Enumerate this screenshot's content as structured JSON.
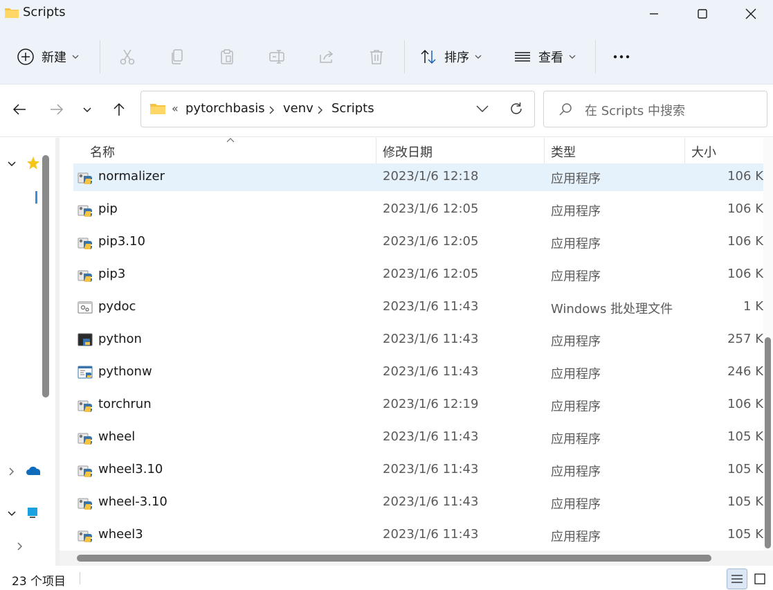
{
  "window": {
    "title": "Scripts"
  },
  "toolbar": {
    "new_label": "新建",
    "sort_label": "排序",
    "view_label": "查看"
  },
  "address": {
    "overflow": "«",
    "crumbs": [
      "pytorchbasis",
      "venv",
      "Scripts"
    ]
  },
  "search": {
    "placeholder": "在 Scripts 中搜索"
  },
  "columns": {
    "name": "名称",
    "date": "修改日期",
    "type": "类型",
    "size": "大小"
  },
  "files": [
    {
      "name": "normalizer",
      "date": "2023/1/6 12:18",
      "type": "应用程序",
      "size": "106 K",
      "icon": "python-exe-icon"
    },
    {
      "name": "pip",
      "date": "2023/1/6 12:05",
      "type": "应用程序",
      "size": "106 K",
      "icon": "python-exe-icon"
    },
    {
      "name": "pip3.10",
      "date": "2023/1/6 12:05",
      "type": "应用程序",
      "size": "106 K",
      "icon": "python-exe-icon"
    },
    {
      "name": "pip3",
      "date": "2023/1/6 12:05",
      "type": "应用程序",
      "size": "106 K",
      "icon": "python-exe-icon"
    },
    {
      "name": "pydoc",
      "date": "2023/1/6 11:43",
      "type": "Windows 批处理文件",
      "size": "1 K",
      "icon": "batch-file-icon"
    },
    {
      "name": "python",
      "date": "2023/1/6 11:43",
      "type": "应用程序",
      "size": "257 K",
      "icon": "python-console-icon"
    },
    {
      "name": "pythonw",
      "date": "2023/1/6 11:43",
      "type": "应用程序",
      "size": "246 K",
      "icon": "python-window-icon"
    },
    {
      "name": "torchrun",
      "date": "2023/1/6 12:19",
      "type": "应用程序",
      "size": "106 K",
      "icon": "python-exe-icon"
    },
    {
      "name": "wheel",
      "date": "2023/1/6 11:43",
      "type": "应用程序",
      "size": "105 K",
      "icon": "python-exe-icon"
    },
    {
      "name": "wheel3.10",
      "date": "2023/1/6 11:43",
      "type": "应用程序",
      "size": "105 K",
      "icon": "python-exe-icon"
    },
    {
      "name": "wheel-3.10",
      "date": "2023/1/6 11:43",
      "type": "应用程序",
      "size": "105 K",
      "icon": "python-exe-icon"
    },
    {
      "name": "wheel3",
      "date": "2023/1/6 11:43",
      "type": "应用程序",
      "size": "105 K",
      "icon": "python-exe-icon"
    }
  ],
  "status": {
    "item_count": "23 个项目"
  },
  "colors": {
    "selected_row": "#e5f1fb",
    "chrome_bg": "#eef3f9",
    "folder": "#f6c343"
  }
}
